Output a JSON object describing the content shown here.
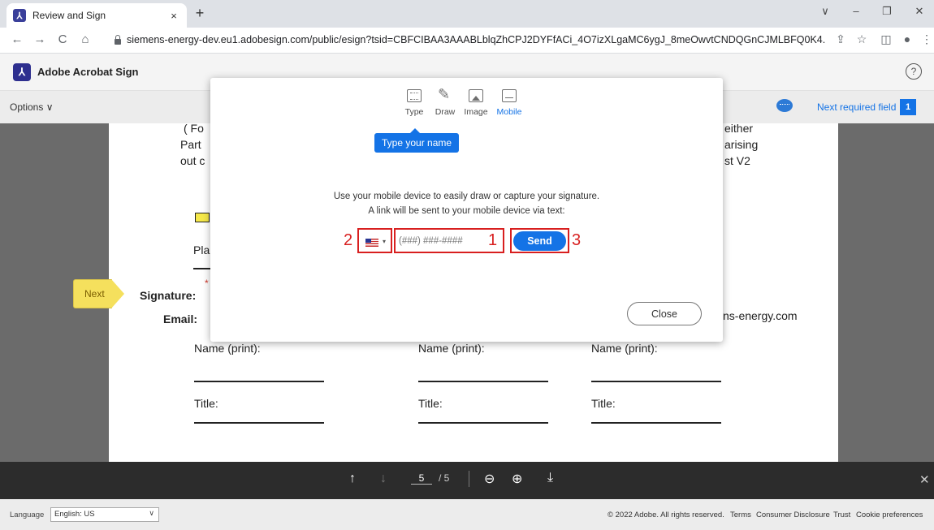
{
  "browser": {
    "tab_title": "Review and Sign",
    "tab_close": "×",
    "new_tab": "+",
    "url": "siemens-energy-dev.eu1.adobesign.com/public/esign?tsid=CBFCIBAA3AAABLblqZhCPJ2DYFfACi_4O7izXLgaMC6ygJ_8meOwvtCNDQGnCJMLBFQ0K4...",
    "controls": {
      "chevron": "∨",
      "minimize": "–",
      "maximize": "❐",
      "close": "✕"
    },
    "nav": {
      "back": "←",
      "forward": "→",
      "reload": "C",
      "home": "⌂"
    },
    "addr_icons": {
      "share": "⇪",
      "star": "☆",
      "sidepanel": "◫",
      "profile": "●",
      "menu": "⋮"
    }
  },
  "app": {
    "logo_glyph": "⅄",
    "title": "Adobe Acrobat Sign",
    "help_glyph": "?",
    "options_label": "Options ∨",
    "next_required": "Next required field",
    "next_required_count": "1"
  },
  "document": {
    "fragments": [
      "( Fo",
      "Part",
      "out c",
      "either",
      "arising",
      "st V2",
      "Pla",
      "ns-energy.com"
    ],
    "next_tag": "Next",
    "asterisk": "*",
    "signature_label": "Signature:",
    "email_label": "Email:",
    "name_print": "Name (print):",
    "title_label": "Title:"
  },
  "modal": {
    "tabs": [
      {
        "label": "Type",
        "icon": "keyboard-icon"
      },
      {
        "label": "Draw",
        "icon": "pen-icon"
      },
      {
        "label": "Image",
        "icon": "image-icon"
      },
      {
        "label": "Mobile",
        "icon": "mobile-icon"
      }
    ],
    "active_tab": "Mobile",
    "tooltip": "Type your name",
    "instruction_line1": "Use your mobile device to easily draw or capture your signature.",
    "instruction_line2": "A link will be sent to your mobile device via text:",
    "country_caret": "▾",
    "phone_placeholder": "(###) ###-####",
    "send_label": "Send",
    "close_label": "Close",
    "markers": [
      "1",
      "2",
      "3"
    ]
  },
  "toolbar": {
    "up": "↑",
    "down": "↓",
    "page_current": "5",
    "page_total": "/ 5",
    "zoom_out": "⊖",
    "zoom_in": "⊕",
    "download": "⤓",
    "close": "✕"
  },
  "footer": {
    "language_label": "Language",
    "language_value": "English: US",
    "language_caret": "∨",
    "copyright": "© 2022 Adobe. All rights reserved.",
    "links": [
      "Terms",
      "Consumer Disclosure",
      "Trust",
      "Cookie preferences"
    ]
  },
  "colors": {
    "accent": "#1473e6",
    "annotation_red": "#d81f1f",
    "toolbar_dark": "#2c2c2c"
  }
}
